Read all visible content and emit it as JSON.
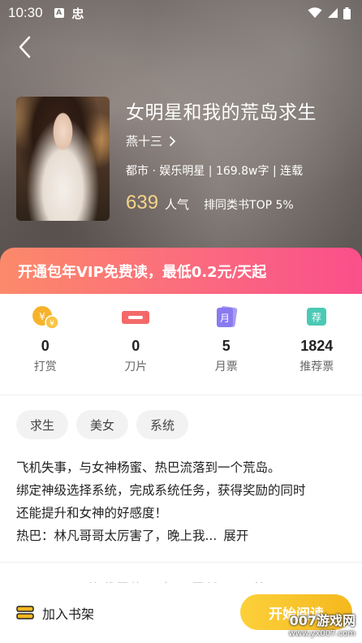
{
  "status_bar": {
    "time": "10:30",
    "sim_letter": "A",
    "app_glyph": "忠"
  },
  "book": {
    "title": "女明星和我的荒岛求生",
    "author": "燕十三",
    "meta": "都市 · 娱乐明星 | 169.8w字 | 连载",
    "popularity_value": "639",
    "popularity_label": "人气",
    "rank": "排同类书TOP 5%"
  },
  "vip_banner": "开通包年VIP免费读，最低0.2元/天起",
  "stats": [
    {
      "icon": "coin-icon",
      "value": "0",
      "label": "打赏"
    },
    {
      "icon": "blade-icon",
      "value": "0",
      "label": "刀片"
    },
    {
      "icon": "month-ticket-icon",
      "value": "5",
      "label": "月票",
      "icon_text": "月"
    },
    {
      "icon": "recommend-ticket-icon",
      "value": "1824",
      "label": "推荐票",
      "icon_text": "荐"
    }
  ],
  "tags": [
    "求生",
    "美女",
    "系统"
  ],
  "description": {
    "line1": "飞机失事，与女神杨蜜、热巴流落到一个荒岛。",
    "line2": "绑定神级选择系统，完成系统任务，获得奖励的同时",
    "line3": "还能提升和女神的好感度！",
    "line4": "热巴：林凡哥哥太厉害了，晚上我...",
    "expand": "展开"
  },
  "catalog_peek": {
    "label": "目录",
    "text": "连载至第1 章 · 更新于 天前"
  },
  "bottom": {
    "add_shelf": "加入书架",
    "start_read": "开始阅读"
  },
  "watermark": {
    "main": "007游戏网",
    "sub": "www.yx007.com"
  },
  "colors": {
    "accent_gold": "#f7d48a",
    "vip_start": "#fc8a6a",
    "vip_end": "#fa4f8b",
    "read_button": "#fcd03a"
  }
}
